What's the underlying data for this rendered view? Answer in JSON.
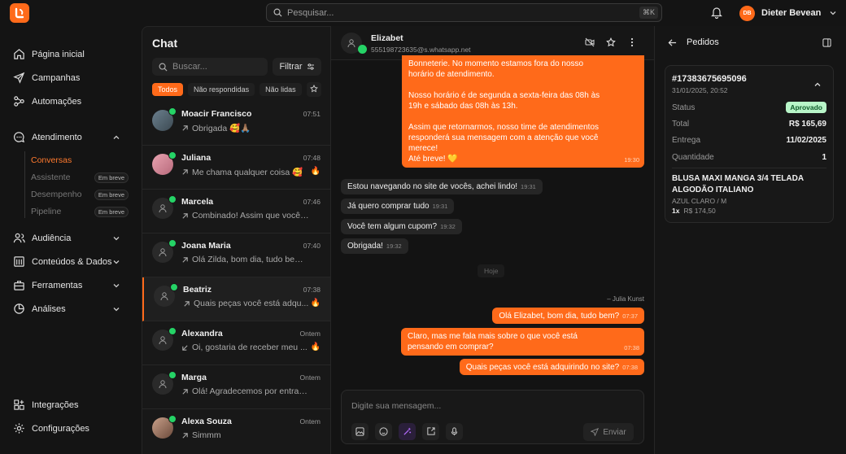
{
  "topbar": {
    "search_placeholder": "Pesquisar...",
    "search_shortcut": "⌘K",
    "user_initials": "DB",
    "user_name": "Dieter Bevean"
  },
  "sidebar": {
    "items": [
      {
        "label": "Página inicial",
        "icon": "home-icon"
      },
      {
        "label": "Campanhas",
        "icon": "send-icon"
      },
      {
        "label": "Automações",
        "icon": "automation-icon"
      },
      {
        "label": "Atendimento",
        "icon": "chat-bubble-icon"
      },
      {
        "label": "Audiência",
        "icon": "users-icon"
      },
      {
        "label": "Conteúdos & Dados",
        "icon": "library-icon"
      },
      {
        "label": "Ferramentas",
        "icon": "toolbox-icon"
      },
      {
        "label": "Análises",
        "icon": "pie-chart-icon"
      },
      {
        "label": "Integrações",
        "icon": "grid-plus-icon"
      },
      {
        "label": "Configurações",
        "icon": "gear-icon"
      }
    ],
    "subitems": [
      {
        "label": "Conversas",
        "badge": ""
      },
      {
        "label": "Assistente",
        "badge": "Em breve"
      },
      {
        "label": "Desempenho",
        "badge": "Em breve"
      },
      {
        "label": "Pipeline",
        "badge": "Em breve"
      }
    ]
  },
  "chatlist": {
    "title": "Chat",
    "search_placeholder": "Buscar...",
    "filter_label": "Filtrar",
    "tabs": [
      "Todos",
      "Não respondidas",
      "Não lidas"
    ],
    "conversations": [
      {
        "name": "Moacir Francisco",
        "time": "07:51",
        "preview": "Obrigada 🥰🙏🏽",
        "fire": ""
      },
      {
        "name": "Juliana",
        "time": "07:48",
        "preview": "Me chama qualquer coisa 🥰",
        "fire": "🔥"
      },
      {
        "name": "Marcela",
        "time": "07:46",
        "preview": "Combinado! Assim que você es...",
        "fire": ""
      },
      {
        "name": "Joana Maria",
        "time": "07:40",
        "preview": "Olá Zilda, bom dia, tudo bem? C...",
        "fire": ""
      },
      {
        "name": "Beatriz",
        "time": "07:38",
        "preview": "Quais peças você está adqu...",
        "fire": "🔥"
      },
      {
        "name": "Alexandra",
        "time": "Ontem",
        "preview": "Oi, gostaria de receber meu ...",
        "fire": "🔥"
      },
      {
        "name": "Marga",
        "time": "Ontem",
        "preview": "Olá! Agradecemos por entrar e...",
        "fire": ""
      },
      {
        "name": "Alexa Souza",
        "time": "Ontem",
        "preview": "Simmm",
        "fire": ""
      }
    ]
  },
  "conversation": {
    "contact_name": "Elizabet",
    "contact_phone": "555198723635@s.whatsapp.net",
    "auto_reply": {
      "lines": [
        "Bonneterie. No momento estamos fora do nosso",
        "horário de atendimento.",
        "",
        "Nosso horário é de segunda a sexta-feira das 08h às",
        "19h e sábado das 08h às 13h.",
        "",
        "Assim que retornarmos, nosso time de atendimentos",
        "responderá sua mensagem com a atenção que você",
        "merece!",
        "Até breve! 💛"
      ],
      "time": "19:30"
    },
    "incoming": [
      {
        "text": "Estou navegando no site de vocês, achei lindo!",
        "time": "19:31"
      },
      {
        "text": "Já quero comprar tudo",
        "time": "19:31"
      },
      {
        "text": "Você tem algum cupom?",
        "time": "19:32"
      },
      {
        "text": "Obrigada!",
        "time": "19:32"
      }
    ],
    "day_separator": "Hoje",
    "agent_name": "– Julia Kunst",
    "outgoing": [
      {
        "lines": [
          "Olá Elizabet, bom dia, tudo bem?"
        ],
        "time": "07:37"
      },
      {
        "lines": [
          "Claro, mas me fala mais sobre o que você está",
          "pensando em comprar?"
        ],
        "time": "07:38"
      },
      {
        "lines": [
          "Quais peças você está adquirindo no site?"
        ],
        "time": "07:38"
      }
    ],
    "composer_placeholder": "Digite sua mensagem...",
    "send_label": "Enviar"
  },
  "orders": {
    "title": "Pedidos",
    "order_number": "#17383675695096",
    "order_datetime": "31/01/2025, 20:52",
    "fields": [
      {
        "label": "Status",
        "value": "Aprovado"
      },
      {
        "label": "Total",
        "value": "R$ 165,69"
      },
      {
        "label": "Entrega",
        "value": "11/02/2025"
      },
      {
        "label": "Quantidade",
        "value": "1"
      }
    ],
    "product_name": "BLUSA MAXI MANGA 3/4 TELADA ALGODÃO ITALIANO",
    "product_variant": "AZUL CLARO / M",
    "product_qty": "1x",
    "product_price": "R$ 174,50"
  },
  "colors": {
    "accent": "#ff6a1a",
    "whatsapp": "#25d366",
    "status_bg": "#b8f5c8"
  }
}
